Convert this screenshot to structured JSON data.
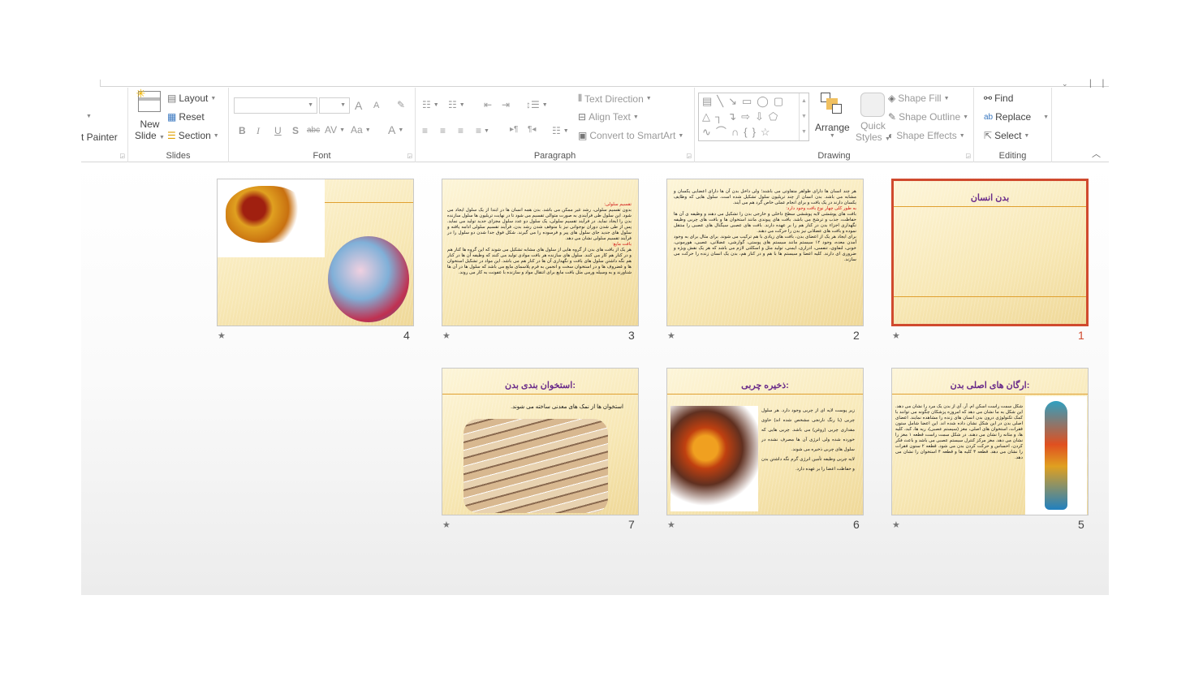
{
  "ribbon": {
    "clipboard": {
      "format_painter": "t Painter"
    },
    "slides": {
      "label": "Slides",
      "new_slide_1": "New",
      "new_slide_2": "Slide",
      "layout": "Layout",
      "reset": "Reset",
      "section": "Section"
    },
    "font": {
      "label": "Font",
      "font_name": "",
      "font_size": "",
      "bold": "B",
      "italic": "I",
      "underline": "U",
      "shadow": "S",
      "strike": "abc",
      "spacing": "AV",
      "case": "Aa",
      "color": "A",
      "grow": "A",
      "shrink": "A"
    },
    "paragraph": {
      "label": "Paragraph",
      "text_direction": "Text Direction",
      "align_text": "Align Text",
      "smartart": "Convert to SmartArt"
    },
    "drawing": {
      "label": "Drawing",
      "arrange": "Arrange",
      "quick_styles_1": "Quick",
      "quick_styles_2": "Styles",
      "shape_fill": "Shape Fill",
      "shape_outline": "Shape Outline",
      "shape_effects": "Shape Effects"
    },
    "editing": {
      "label": "Editing",
      "find": "Find",
      "replace": "Replace",
      "select": "Select"
    }
  },
  "colors": {
    "selection": "#d04a2e",
    "title": "#6a2b8a",
    "accent_line": "#e0a030"
  },
  "slides": [
    {
      "number": "1",
      "title": "بدن انسان",
      "selected": true,
      "body": []
    },
    {
      "number": "2",
      "title": "",
      "body": [
        {
          "t": "هر چند انسان ها دارای ظواهر متفاوتی می باشند؛ ولی داخل بدن آن ها دارای اعضایی یکسان و مشابه می باشد. بدن انسان از چند تریلیون سلول تشکیل شده است. سلول هایی که وظایف یکسان دارند در یک بافت و برای انجام عملی خاص گرد هم می آیند."
        },
        {
          "t": "به طور کلی چهار نوع بافت وجود دارد:",
          "red": true
        },
        {
          "t": "بافت های پوششی لایه پوششی سطح داخلی و خارجی بدن را تشکیل می دهند و وظیفه ی آن ها حفاظت، جذب و ترشح می باشد. بافت های پیوندی مانند استخوان ها و بافت های چربی وظیفه نگهداری اجزاء بدن در کنار هم را بر عهده دارند. بافت های عصبی سیگنال های عصبی را منتقل نموده و بافت های عضلانی نیز بدن را حرکت می دهند."
        },
        {
          "t": "برای ایجاد هر یک از اعضای بدن، بافت های زیادی با هم ترکیب می شوند. برای مثال برای به وجود آمدن معده، وجود ۱۲ سیستم مانند سیستم های پوستی، گوارشی، عضلانی، عصبی، هورمونی، خونی، لنفاوی، تنفسی، ادراری، ایمنی، تولید مثل و اسکلتی لازم می باشد که هر یک نقش ویژه و ضروری ای دارند. کلیه اعضا و سیستم ها با هم و در کنار هم، بدن یک انسان زنده را حرکت می سازند."
        }
      ]
    },
    {
      "number": "3",
      "title": "",
      "body": [
        {
          "t": "تقسیم سلولی:",
          "red": true
        },
        {
          "t": "بدون تقسیم سلولی، رشد غیر ممکن می باشد. بدن همه انسان ها در ابتدا از یک سلول ایجاد می شود. این سلول طی فرآیندی به صورت متوالی تقسیم می شود تا در نهایت تریلیون ها سلول سازنده بدن را ایجاد نماید. در فرآیند تقسیم سلولی، یک سلول دو عدد سلول مجزای جدید تولید می نماید. پس از طی شدن دوران نوجوانی نیز با متوقف شدن رشد بدن، فرآیند تقسیم سلولی ادامه یافته و سلول های جدید جای سلول های پیر و فرسوده را می گیرند. شکل فوق جدا شدن دو سلول را در فرآیند تقسیم سلولی نشان می دهد."
        },
        {
          "t": "بافت مایع:",
          "red": true
        },
        {
          "t": "هر یک از بافت های بدن از گروه هایی از سلول های مشابه تشکیل می شوند که این گروه ها کنار هم و در کنار هم کار می کنند. سلول های سازنده هر بافت موادی تولید می کنند که وظیفه آن ها در کنار هم نگه داشتن سلول های بافت و نگهداری آن ها در کنار هم می باشد. این مواد در تشکیل استخوان ها و غضروف ها و در استخوان سخت و انجمن به فرم پلاسمای مایع می باشد که سلول ها در آن ها شناورند و به وسیله ورمی مثل بافت مایع برای انتقال مواد و سازنده با عفونت به کار می روند."
        }
      ]
    },
    {
      "number": "4",
      "title": "",
      "body": []
    },
    {
      "number": "5",
      "title": "ارگان های اصلی بدن:",
      "body": [
        {
          "t": "شکل سمت راست اسکن ام. آر. آی از بدن یک مرد را نشان می دهد. این شکل به ما نشان می دهد که امروزه پزشکان چگونه می توانند با کمک تکنولوژی درون بدن انسان های زنده را مشاهده نمایند. اعضای اصلی بدن در این شکل نشان داده شده اند. این اعضا شامل ستون فقرات، استخوان های اصلی، مغز (سیستم عصبی)، ریه ها، کبد، کلیه ها، و مثانه را نشان می دهند. در شکل سمت راست قطعه ۱ مغز را نشان می دهد. مغز مرکز کنترل سیستم عصبی می باشد و باعث فکر کردن، احساس و حرکت کردن بدن می شود. قطعه ۲ ستون فقرات را نشان می دهد. قطعه ۳ کلیه ها و قطعه ۴ استخوان را نشان می دهد."
        }
      ]
    },
    {
      "number": "6",
      "title": "ذخیره چربی:",
      "body": [
        {
          "t": "زیر پوست لایه ای از چربی وجود دارد. هر سلول چربی (با رنگ نارنجی مشخص شده اند) حاوی مقداری چربی (روغن) می باشد. چربی هایی که خورده شده ولی انرژی آن ها مصرف نشده در سلول های چربی ذخیره می شوند."
        },
        {
          "t": "لایه چربی وظیفه تأمین انرژی گرم نگه داشتن بدن و حفاظت اعضا را بر عهده دارد."
        }
      ]
    },
    {
      "number": "7",
      "title": "استخوان بندی بدن:",
      "body": [
        {
          "t": "استخوان ها از نمک های معدنی ساخته می شوند."
        }
      ]
    }
  ]
}
